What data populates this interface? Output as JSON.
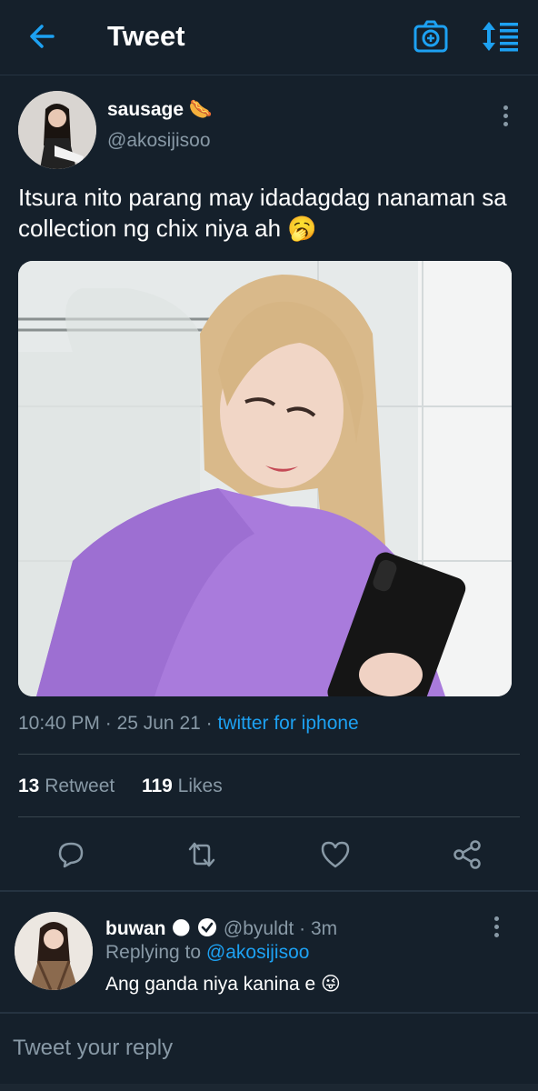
{
  "header": {
    "title": "Tweet"
  },
  "icons": {
    "back": "back-arrow-icon",
    "camera": "camera-plus-icon",
    "sort": "sort-icon",
    "more": "more-vertical-icon"
  },
  "tweet": {
    "display_name": "sausage 🌭",
    "handle": "@akosijisoo",
    "text": "Itsura nito parang may idadagdag nanaman sa collection ng chix niya ah 🥱",
    "time": "10:40 PM",
    "date": "25 Jun 21",
    "source": "twitter for iphone",
    "retweet_count": "13",
    "retweet_label": "Retweet",
    "like_count": "119",
    "like_label": "Likes"
  },
  "actions": [
    "reply-icon",
    "retweet-icon",
    "like-icon",
    "share-icon"
  ],
  "reply": {
    "display_name": "buwan 🌑",
    "handle": "@byuldt",
    "time": "3m",
    "replying_label": "Replying to",
    "replying_to": "@akosijisoo",
    "text": "Ang ganda niya kanina e 😜"
  },
  "composer": {
    "placeholder": "Tweet your reply"
  },
  "colors": {
    "background": "#15202b",
    "accent": "#1da1f2",
    "muted": "#8899a6",
    "divider": "#38444d"
  }
}
